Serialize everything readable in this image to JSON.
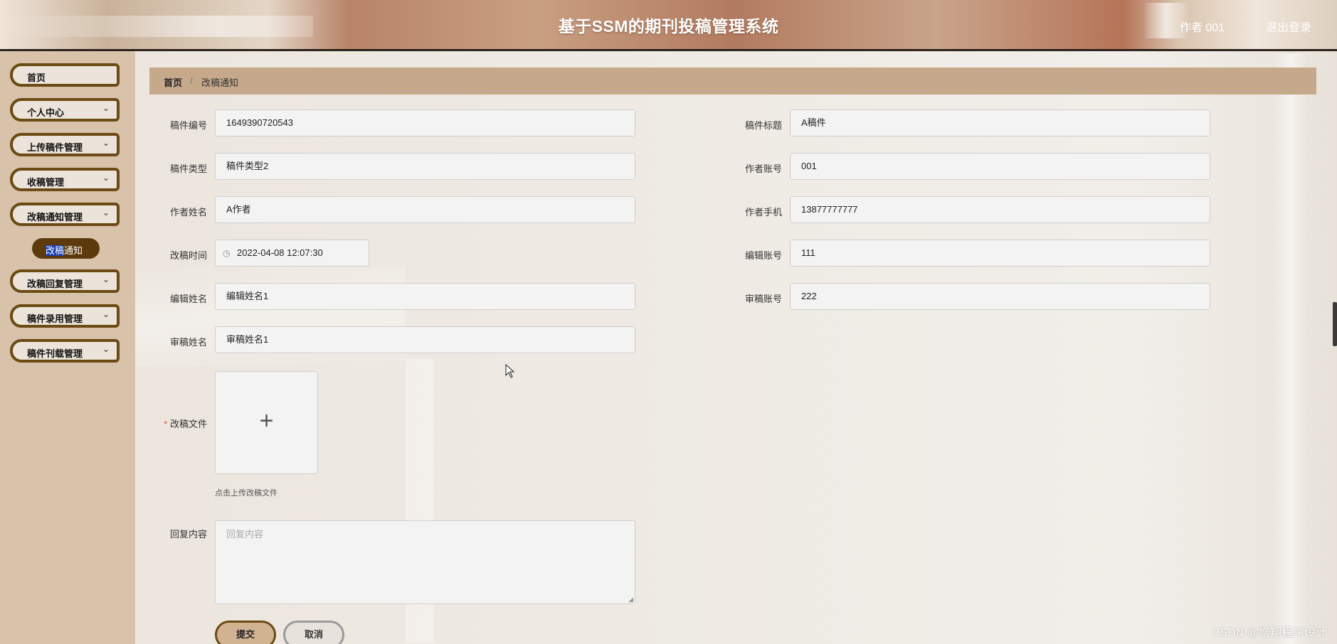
{
  "app": {
    "title": "基于SSM的期刊投稿管理系统",
    "user": "作者 001",
    "logout": "退出登录"
  },
  "sidebar": {
    "items": [
      {
        "label": "首页",
        "has_chevron": false
      },
      {
        "label": "个人中心",
        "has_chevron": true
      },
      {
        "label": "上传稿件管理",
        "has_chevron": true
      },
      {
        "label": "收稿管理",
        "has_chevron": true
      },
      {
        "label": "改稿通知管理",
        "has_chevron": true,
        "expanded": true
      },
      {
        "label": "改稿回复管理",
        "has_chevron": true
      },
      {
        "label": "稿件录用管理",
        "has_chevron": true
      },
      {
        "label": "稿件刊载管理",
        "has_chevron": true
      }
    ],
    "submenu": {
      "selected_part": "改稿",
      "rest": "通知"
    }
  },
  "breadcrumb": {
    "home": "首页",
    "separator": "/",
    "current": "改稿通知"
  },
  "form": {
    "manuscript_no": {
      "label": "稿件编号",
      "value": "1649390720543"
    },
    "manuscript_title": {
      "label": "稿件标题",
      "value": "A稿件"
    },
    "manuscript_type": {
      "label": "稿件类型",
      "value": "稿件类型2"
    },
    "author_account": {
      "label": "作者账号",
      "value": "001"
    },
    "author_name": {
      "label": "作者姓名",
      "value": "A作者"
    },
    "author_phone": {
      "label": "作者手机",
      "value": "13877777777"
    },
    "revision_time": {
      "label": "改稿时间",
      "value": "2022-04-08 12:07:30"
    },
    "editor_account": {
      "label": "编辑账号",
      "value": "111"
    },
    "editor_name": {
      "label": "编辑姓名",
      "value": "编辑姓名1"
    },
    "reviewer_account": {
      "label": "审稿账号",
      "value": "222"
    },
    "reviewer_name": {
      "label": "审稿姓名",
      "value": "审稿姓名1"
    },
    "revision_file": {
      "label": "改稿文件",
      "required_mark": "*",
      "hint": "点击上传改稿文件"
    },
    "reply_content": {
      "label": "回复内容",
      "placeholder": "回复内容"
    }
  },
  "buttons": {
    "submit": "提交",
    "cancel": "取消"
  },
  "watermark": "CSDN @增翔程序设计",
  "colors": {
    "sidebar_bg": "#d8c2a9",
    "menu_border": "#6b4a14",
    "breadcrumb_bg": "#c6a98b",
    "submenu_bg": "#5c3a0c"
  }
}
